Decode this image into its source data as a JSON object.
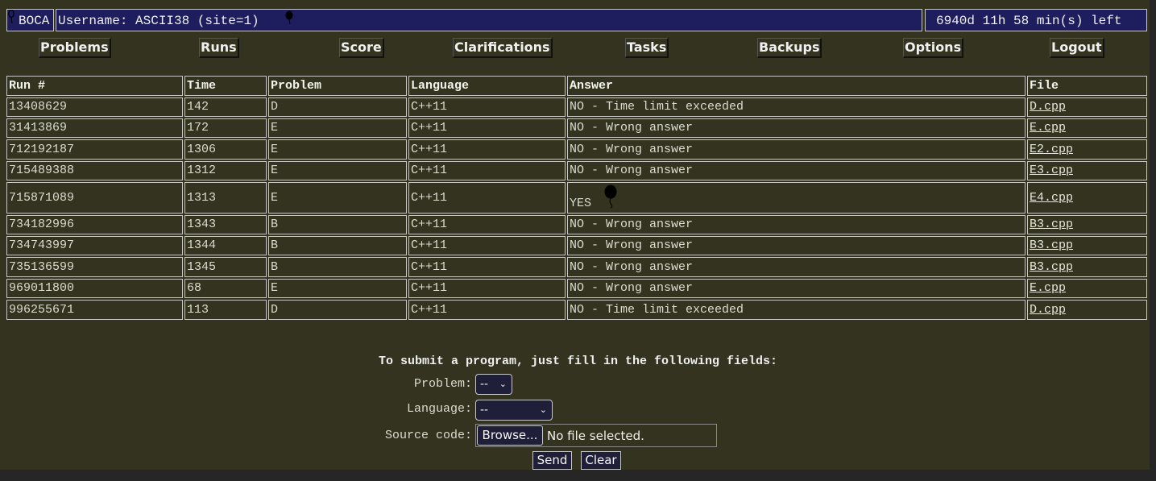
{
  "header": {
    "logo": "BOCA",
    "user": "Username: ASCII38 (site=1)",
    "time_left": "6940d 11h 58 min(s) left"
  },
  "nav": [
    "Problems",
    "Runs",
    "Score",
    "Clarifications",
    "Tasks",
    "Backups",
    "Options",
    "Logout"
  ],
  "table": {
    "columns": [
      "Run #",
      "Time",
      "Problem",
      "Language",
      "Answer",
      "File"
    ],
    "rows": [
      [
        "13408629",
        "142",
        "D",
        "C++11",
        "NO - Time limit exceeded",
        "D.cpp"
      ],
      [
        "31413869",
        "172",
        "E",
        "C++11",
        "NO - Wrong answer",
        "E.cpp"
      ],
      [
        "712192187",
        "1306",
        "E",
        "C++11",
        "NO - Wrong answer",
        "E2.cpp"
      ],
      [
        "715489388",
        "1312",
        "E",
        "C++11",
        "NO - Wrong answer",
        "E3.cpp"
      ],
      [
        "715871089",
        "1313",
        "E",
        "C++11",
        "YES",
        "E4.cpp"
      ],
      [
        "734182996",
        "1343",
        "B",
        "C++11",
        "NO - Wrong answer",
        "B3.cpp"
      ],
      [
        "734743997",
        "1344",
        "B",
        "C++11",
        "NO - Wrong answer",
        "B3.cpp"
      ],
      [
        "735136599",
        "1345",
        "B",
        "C++11",
        "NO - Wrong answer",
        "B3.cpp"
      ],
      [
        "969011800",
        "68",
        "E",
        "C++11",
        "NO - Wrong answer",
        "E.cpp"
      ],
      [
        "996255671",
        "113",
        "D",
        "C++11",
        "NO - Time limit exceeded",
        "D.cpp"
      ]
    ]
  },
  "form": {
    "title": "To submit a program, just fill in the following fields:",
    "problem_label": "Problem:",
    "problem_value": "--",
    "language_label": "Language:",
    "language_value": "--",
    "source_label": "Source code:",
    "browse_label": "Browse...",
    "file_status": "No file selected.",
    "send_label": "Send",
    "clear_label": "Clear"
  },
  "icons": {
    "balloon": "balloon-icon"
  }
}
